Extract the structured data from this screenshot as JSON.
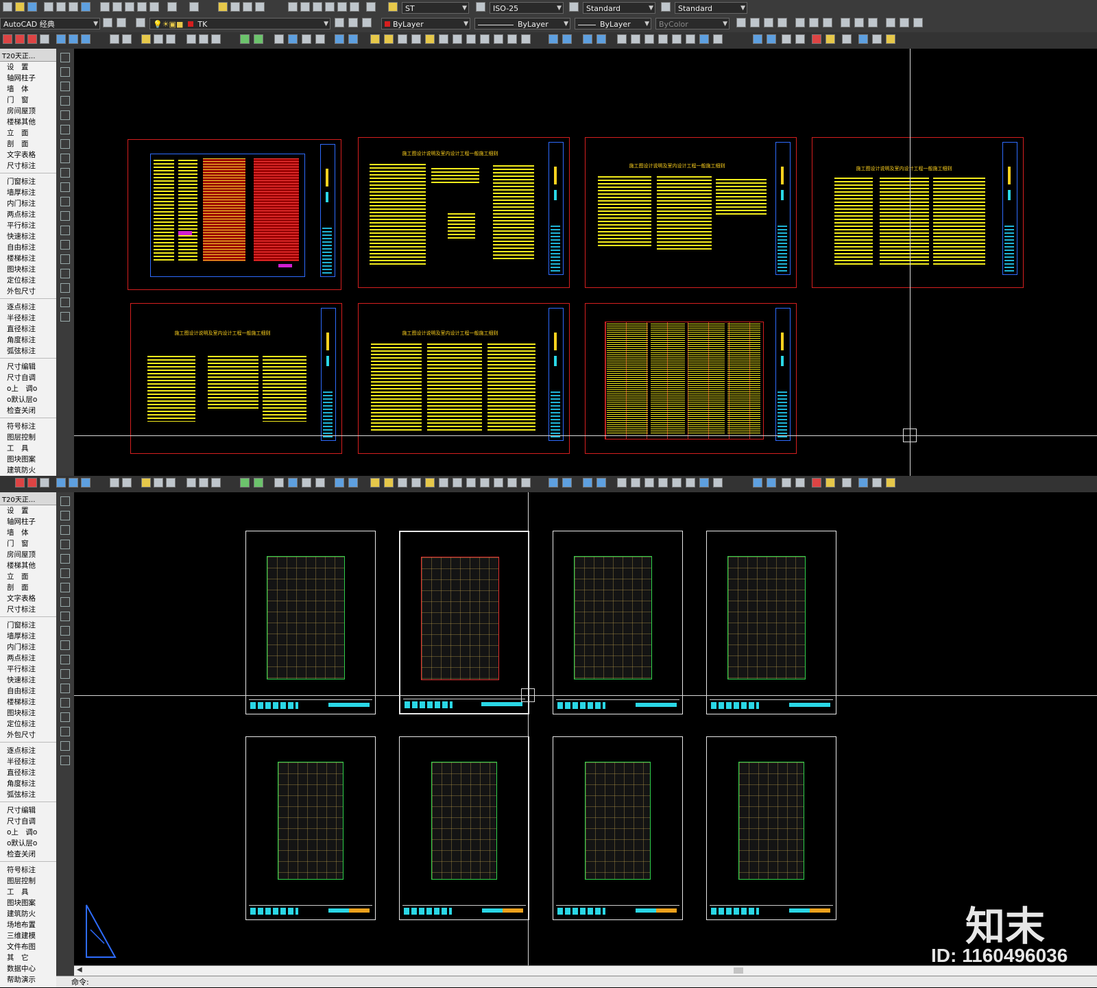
{
  "toolbar1": {
    "text_style": "ST",
    "dim_style": "ISO-25",
    "table_style": "Standard",
    "mleader_style": "Standard"
  },
  "toolbar2": {
    "workspace": "AutoCAD 经典",
    "layer": "TK",
    "color": "ByLayer",
    "linetype": "ByLayer",
    "lineweight": "ByLayer",
    "plotstyle": "ByColor"
  },
  "sidebar_top": {
    "title": "T20天正...",
    "items": [
      "设　置",
      "轴网柱子",
      "墙　体",
      "门　窗",
      "房间屋顶",
      "楼梯其他",
      "立　面",
      "剖　面",
      "文字表格",
      "尺寸标注",
      "门窗标注",
      "墙厚标注",
      "内门标注",
      "两点标注",
      "平行标注",
      "快速标注",
      "自由标注",
      "楼梯标注",
      "图块标注",
      "定位标注",
      "外包尺寸",
      "逐点标注",
      "半径标注",
      "直径标注",
      "角度标注",
      "弧弦标注",
      "尺寸编辑",
      "尺寸自调",
      "o上　调o",
      "o默认层o",
      "检查关闭",
      "符号标注",
      "图层控制",
      "工　具",
      "图块图案",
      "建筑防火"
    ]
  },
  "sidebar_bottom": {
    "title": "T20天正...",
    "items": [
      "设　置",
      "轴网柱子",
      "墙　体",
      "门　窗",
      "房间屋顶",
      "楼梯其他",
      "立　面",
      "剖　面",
      "文字表格",
      "尺寸标注",
      "门窗标注",
      "墙厚标注",
      "内门标注",
      "两点标注",
      "平行标注",
      "快速标注",
      "自由标注",
      "楼梯标注",
      "图块标注",
      "定位标注",
      "外包尺寸",
      "逐点标注",
      "半径标注",
      "直径标注",
      "角度标注",
      "弧弦标注",
      "尺寸编辑",
      "尺寸自调",
      "o上　调o",
      "o默认层o",
      "检查关闭",
      "符号标注",
      "图层控制",
      "工　具",
      "图块图案",
      "建筑防火",
      "场地布置",
      "三维建模",
      "文件布图",
      "其　它",
      "数据中心",
      "帮助演示"
    ]
  },
  "sheet_title": "施工图设计说明及室内设计工程一般施工细则",
  "command_label": "命令:",
  "watermark": {
    "logo": "知末",
    "id_text": "ID: 1160496036"
  }
}
